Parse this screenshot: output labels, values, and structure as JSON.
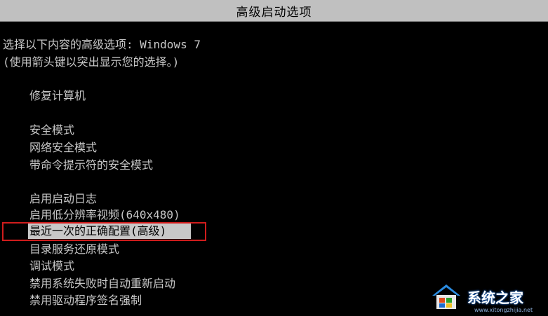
{
  "title": "高级启动选项",
  "prompt": {
    "line1": "选择以下内容的高级选项: Windows 7",
    "line2": "(使用箭头键以突出显示您的选择。)"
  },
  "options": [
    "修复计算机",
    "安全模式",
    "网络安全模式",
    "带命令提示符的安全模式",
    "启用启动日志",
    "启用低分辨率视频(640x480)",
    "最近一次的正确配置(高级)",
    "目录服务还原模式",
    "调试模式",
    "禁用系统失败时自动重新启动",
    "禁用驱动程序签名强制"
  ],
  "selected_option": "最近一次的正确配置(高级)",
  "colors": {
    "background": "#000000",
    "text": "#c8c8c8",
    "title_bar": "#c0c0c0",
    "highlight_box": "#d01c1c"
  },
  "watermark": {
    "text": "系统之家",
    "sub": "www.xitongzhijia.net"
  }
}
